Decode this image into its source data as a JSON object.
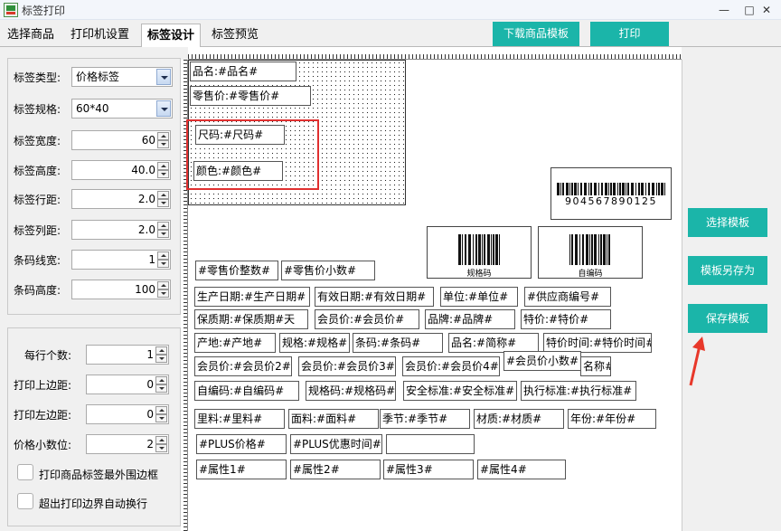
{
  "window": {
    "title": "标签打印",
    "minimize": "—",
    "restore": "□",
    "close": "✕"
  },
  "tabs": [
    {
      "label": "选择商品"
    },
    {
      "label": "打印机设置"
    },
    {
      "label": "标签设计"
    },
    {
      "label": "标签预览"
    }
  ],
  "toolbar": {
    "download_label": "下载商品模板",
    "print_label": "打印"
  },
  "settings": {
    "label_type": {
      "label": "标签类型:",
      "value": "价格标签"
    },
    "label_spec": {
      "label": "标签规格:",
      "value": "60*40"
    },
    "label_width": {
      "label": "标签宽度:",
      "value": "60"
    },
    "label_height": {
      "label": "标签高度:",
      "value": "40.0"
    },
    "row_spacing": {
      "label": "标签行距:",
      "value": "2.0"
    },
    "col_spacing": {
      "label": "标签列距:",
      "value": "2.0"
    },
    "barcode_line_width": {
      "label": "条码线宽:",
      "value": "1"
    },
    "barcode_height": {
      "label": "条码高度:",
      "value": "100"
    }
  },
  "print_settings": {
    "per_row": {
      "label": "每行个数:",
      "value": "1"
    },
    "top_margin": {
      "label": "打印上边距:",
      "value": "0"
    },
    "left_margin": {
      "label": "打印左边距:",
      "value": "0"
    },
    "price_decimals": {
      "label": "价格小数位:",
      "value": "2"
    },
    "outer_border": {
      "label": "打印商品标签最外围边框"
    },
    "auto_wrap": {
      "label": "超出打印边界自动换行"
    }
  },
  "label_fields": {
    "name": "品名:#品名#",
    "retail_price": "零售价:#零售价#",
    "size": "尺码:#尺码#",
    "color": "颜色:#颜色#"
  },
  "barcode_main": {
    "digits": "904567890125"
  },
  "barcode_spec": {
    "caption": "规格码"
  },
  "barcode_code": {
    "caption": "自编码"
  },
  "fields": [
    "#零售价整数#",
    "#零售价小数#",
    "生产日期:#生产日期#",
    "有效日期:#有效日期#",
    "单位:#单位#",
    "#供应商编号#",
    "保质期:#保质期#天",
    "会员价:#会员价#",
    "品牌:#品牌#",
    "特价:#特价#",
    "产地:#产地#",
    "规格:#规格#",
    "条码:#条码#",
    "品名:#简称#",
    "特价时间:#特价时间#",
    "会员价:#会员价2#",
    "会员价:#会员价3#",
    "会员价:#会员价4#",
    "#会员价小数#",
    "名称#",
    "自编码:#自编码#",
    "规格码:#规格码#",
    "安全标准:#安全标准#",
    "执行标准:#执行标准#",
    "里料:#里料#",
    "面料:#面料#",
    "季节:#季节#",
    "材质:#材质#",
    "年份:#年份#",
    "#PLUS价格#",
    "#PLUS优惠时间#",
    "",
    "#属性1#",
    "#属性2#",
    "#属性3#",
    "#属性4#"
  ],
  "side_buttons": {
    "select": "选择模板",
    "save_as": "模板另存为",
    "save": "保存模板"
  },
  "colors": {
    "accent": "#1bb5a9",
    "highlight": "#e03030"
  }
}
